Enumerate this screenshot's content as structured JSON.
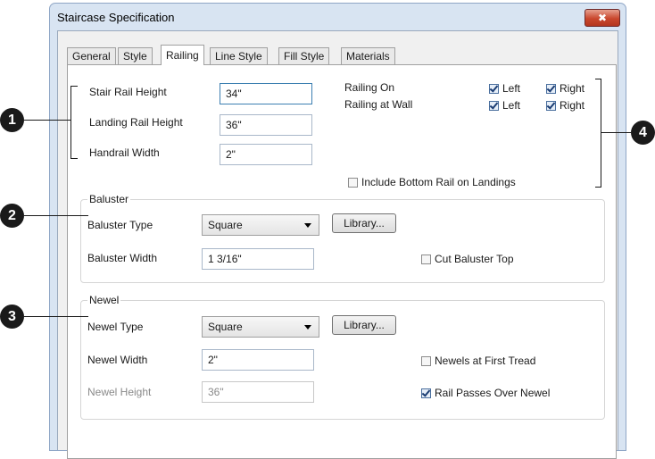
{
  "window": {
    "title": "Staircase Specification",
    "close_label": "✖"
  },
  "tabs": [
    {
      "label": "General"
    },
    {
      "label": "Style"
    },
    {
      "label": "Railing"
    },
    {
      "label": "Line Style"
    },
    {
      "label": "Fill Style"
    },
    {
      "label": "Materials"
    }
  ],
  "rail": {
    "stair_rail_height": {
      "label": "Stair Rail Height",
      "value": "34\""
    },
    "landing_rail_height": {
      "label": "Landing Rail Height",
      "value": "36\""
    },
    "handrail_width": {
      "label": "Handrail Width",
      "value": "2\""
    },
    "railing_on": {
      "label": "Railing On",
      "left": "Left",
      "right": "Right",
      "left_checked": true,
      "right_checked": true
    },
    "railing_at_wall": {
      "label": "Railing at Wall",
      "left": "Left",
      "right": "Right",
      "left_checked": true,
      "right_checked": true
    },
    "include_bottom_rail": {
      "label": "Include Bottom Rail on Landings",
      "checked": false
    }
  },
  "baluster": {
    "group_title": "Baluster",
    "type_label": "Baluster Type",
    "type_value": "Square",
    "library_button": "Library...",
    "width_label": "Baluster Width",
    "width_value": "1 3/16\"",
    "cut_top": {
      "label": "Cut Baluster Top",
      "checked": false
    }
  },
  "newel": {
    "group_title": "Newel",
    "type_label": "Newel Type",
    "type_value": "Square",
    "library_button": "Library...",
    "width_label": "Newel Width",
    "width_value": "2\"",
    "height_label": "Newel Height",
    "height_value": "36\"",
    "first_tread": {
      "label": "Newels at First Tread",
      "checked": false
    },
    "rail_passes": {
      "label": "Rail Passes Over Newel",
      "checked": true
    }
  },
  "callouts": [
    "1",
    "2",
    "3",
    "4"
  ],
  "colors": {
    "accent": "#3c7fb1",
    "close_button": "#c9472d",
    "frame": "#d8e4f2"
  }
}
